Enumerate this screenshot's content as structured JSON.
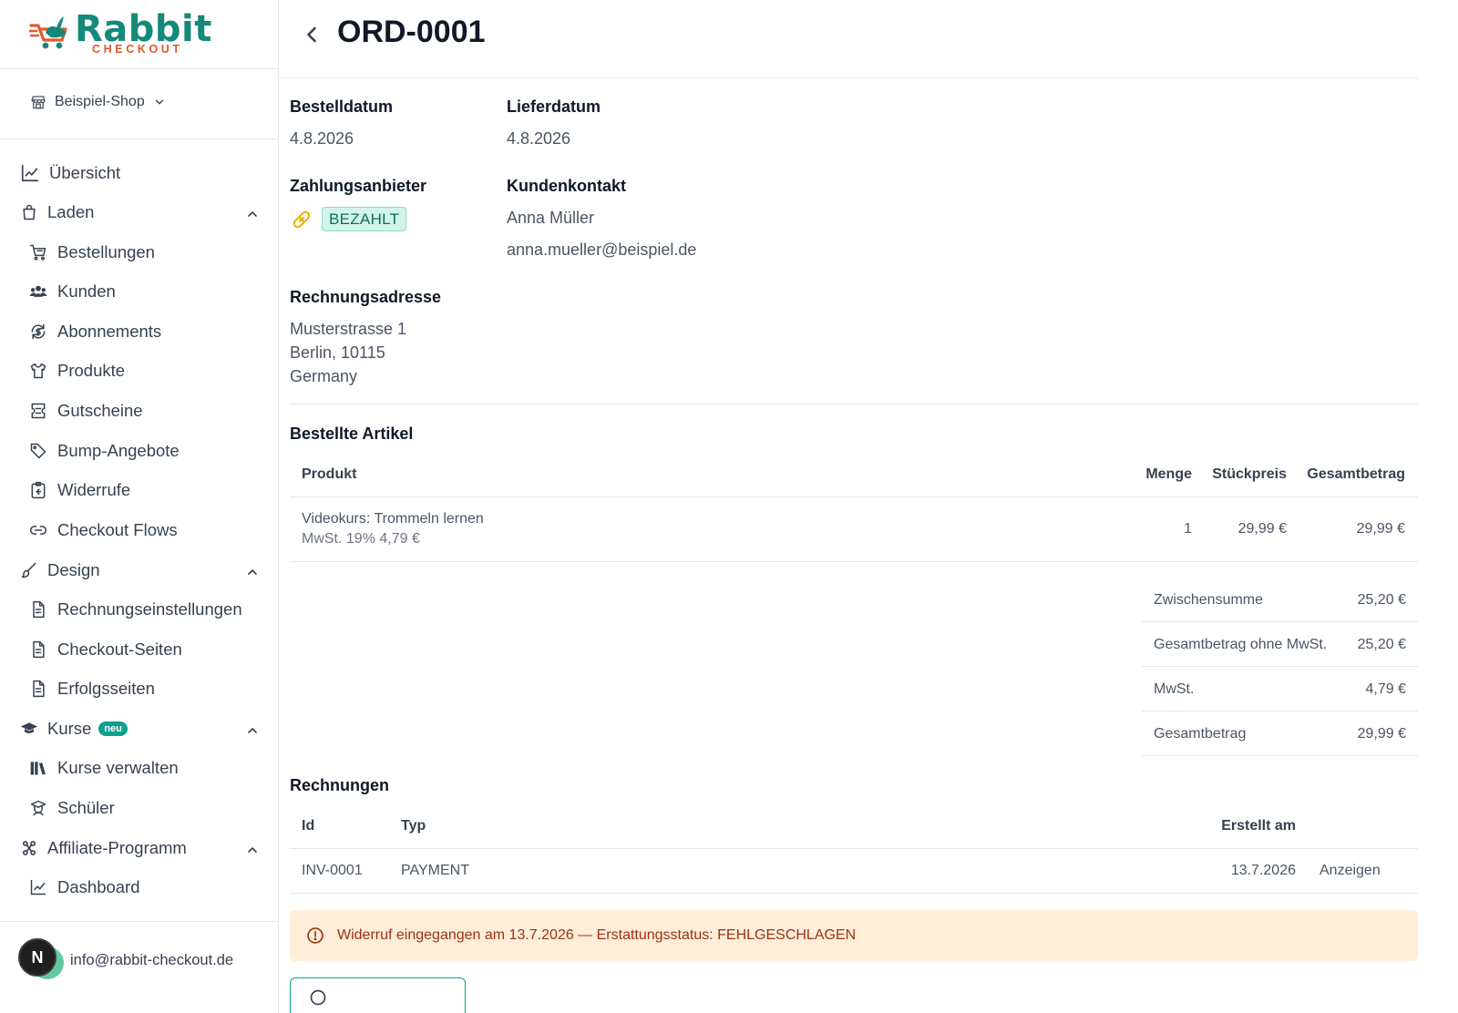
{
  "brand": {
    "name": "Rabbit",
    "sub": "CHECKOUT",
    "primary": "#14897a",
    "accent": "#e0592f"
  },
  "shop": {
    "name": "Beispiel-Shop"
  },
  "nav": {
    "overview": "Übersicht",
    "laden": {
      "label": "Laden",
      "items": [
        "Bestellungen",
        "Kunden",
        "Abonnements",
        "Produkte",
        "Gutscheine",
        "Bump-Angebote",
        "Widerrufe",
        "Checkout Flows"
      ]
    },
    "design": {
      "label": "Design",
      "items": [
        "Rechnungseinstellungen",
        "Checkout-Seiten",
        "Erfolgsseiten"
      ]
    },
    "kurse": {
      "label": "Kurse",
      "badge": "neu",
      "items": [
        "Kurse verwalten",
        "Schüler"
      ]
    },
    "affiliate": {
      "label": "Affiliate-Programm",
      "items": [
        "Dashboard"
      ]
    }
  },
  "user": {
    "initial": "N",
    "email": "info@rabbit-checkout.de"
  },
  "order": {
    "id": "ORD-0001",
    "order_date_label": "Bestelldatum",
    "order_date": "4.8.2026",
    "delivery_date_label": "Lieferdatum",
    "delivery_date": "4.8.2026",
    "payment_provider_label": "Zahlungsanbieter",
    "payment_status": "BEZAHLT",
    "contact_label": "Kundenkontakt",
    "contact_name": "Anna Müller",
    "contact_email": "anna.mueller@beispiel.de",
    "billing_label": "Rechnungsadresse",
    "billing_lines": [
      "Musterstrasse 1",
      "Berlin, 10115",
      "Germany"
    ]
  },
  "items_section": {
    "title": "Bestellte Artikel",
    "headers": {
      "product": "Produkt",
      "qty": "Menge",
      "unit": "Stückpreis",
      "total": "Gesamtbetrag"
    },
    "rows": [
      {
        "product": "Videokurs: Trommeln lernen",
        "tax": "MwSt. 19% 4,79 €",
        "qty": "1",
        "unit": "29,99 €",
        "total": "29,99 €"
      }
    ]
  },
  "summary": [
    {
      "label": "Zwischensumme",
      "value": "25,20 €"
    },
    {
      "label": "Gesamtbetrag ohne MwSt.",
      "value": "25,20 €"
    },
    {
      "label": "MwSt.",
      "value": "4,79 €"
    },
    {
      "label": "Gesamtbetrag",
      "value": "29,99 €"
    }
  ],
  "invoices": {
    "title": "Rechnungen",
    "headers": {
      "id": "Id",
      "type": "Typ",
      "created": "Erstellt am"
    },
    "rows": [
      {
        "id": "INV-0001",
        "type": "PAYMENT",
        "created": "13.7.2026",
        "action": "Anzeigen"
      }
    ]
  },
  "alert": {
    "message": "Widerruf eingegangen am 13.7.2026 — Erstattungsstatus: FEHLGESCHLAGEN",
    "color": "#9a3412",
    "background": "#feedd8"
  },
  "icons": {
    "back": "chevron-left-icon",
    "shop": "store-icon",
    "payment": "bandage-icon",
    "alert": "alert-circle-icon"
  }
}
